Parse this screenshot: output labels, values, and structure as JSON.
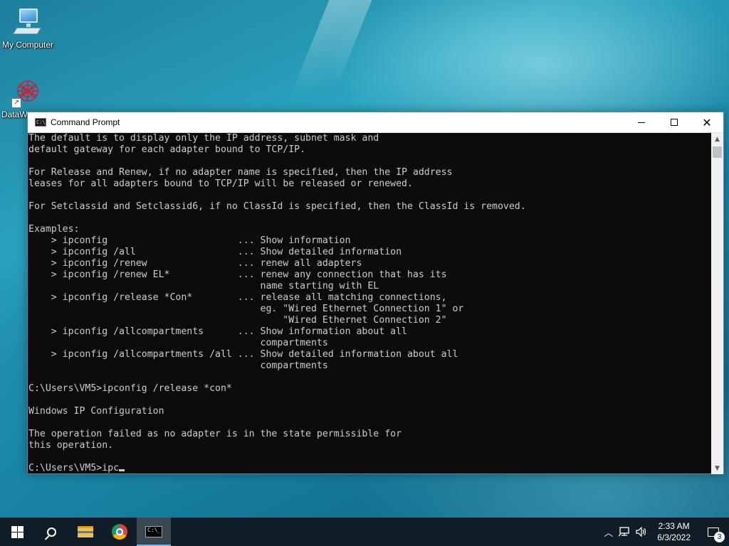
{
  "desktop": {
    "icons": [
      {
        "label": "My Computer",
        "icon": "computer-icon"
      },
      {
        "label": "DataW",
        "icon": "data-app-icon"
      }
    ]
  },
  "window": {
    "title": "Command Prompt",
    "app_icon_text": "C:\\_",
    "controls": {
      "minimize": "minimize",
      "maximize": "maximize",
      "close": "✕"
    }
  },
  "terminal": {
    "lines": [
      "The default is to display only the IP address, subnet mask and",
      "default gateway for each adapter bound to TCP/IP.",
      "",
      "For Release and Renew, if no adapter name is specified, then the IP address",
      "leases for all adapters bound to TCP/IP will be released or renewed.",
      "",
      "For Setclassid and Setclassid6, if no ClassId is specified, then the ClassId is removed.",
      "",
      "Examples:",
      "    > ipconfig                       ... Show information",
      "    > ipconfig /all                  ... Show detailed information",
      "    > ipconfig /renew                ... renew all adapters",
      "    > ipconfig /renew EL*            ... renew any connection that has its",
      "                                         name starting with EL",
      "    > ipconfig /release *Con*        ... release all matching connections,",
      "                                         eg. \"Wired Ethernet Connection 1\" or",
      "                                             \"Wired Ethernet Connection 2\"",
      "    > ipconfig /allcompartments      ... Show information about all",
      "                                         compartments",
      "    > ipconfig /allcompartments /all ... Show detailed information about all",
      "                                         compartments",
      "",
      "C:\\Users\\VM5>ipconfig /release *con*",
      "",
      "Windows IP Configuration",
      "",
      "The operation failed as no adapter is in the state permissible for",
      "this operation.",
      ""
    ],
    "prompt_line": "C:\\Users\\VM5>ipc"
  },
  "taskbar": {
    "apps": [
      "start-icon",
      "search-icon",
      "file-explorer-icon",
      "chrome-icon",
      "command-prompt-icon"
    ],
    "clock": {
      "time": "2:33 AM",
      "date": "6/3/2022"
    },
    "notification_count": "3"
  }
}
